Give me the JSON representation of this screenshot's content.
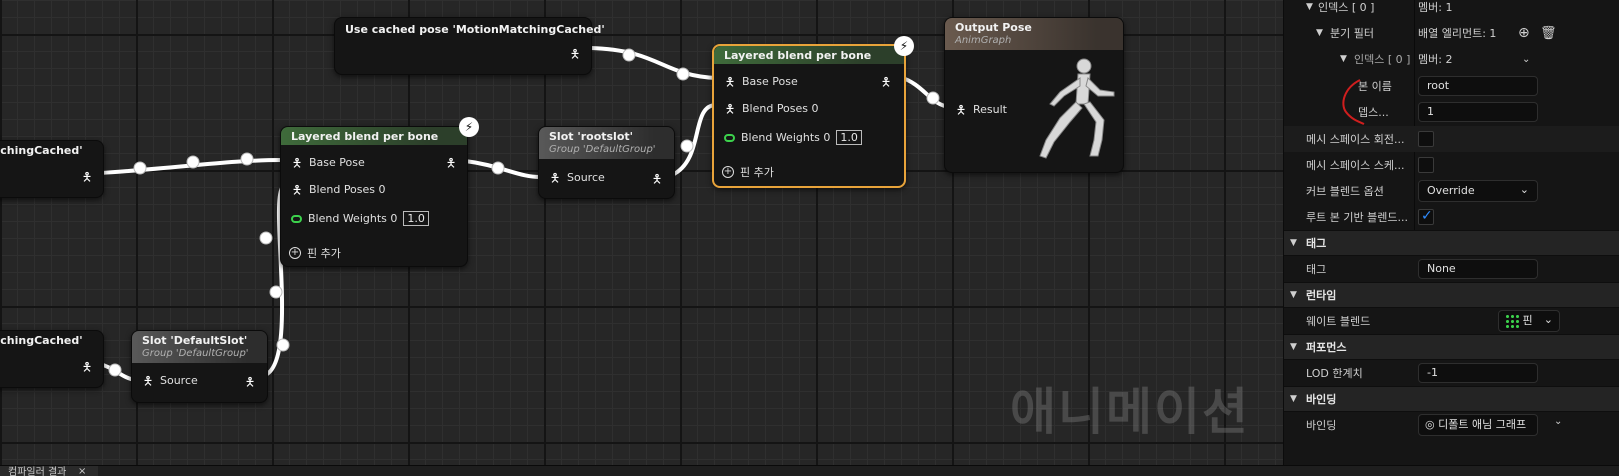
{
  "graph": {
    "watermark": "애니메이션",
    "cached_pose_node": {
      "title": "Use cached pose 'MotionMatchingCached'"
    },
    "left_node_1": {
      "title": "tchingCached'"
    },
    "left_node_2": {
      "title": "tchingCached'"
    },
    "slot_default": {
      "title": "Slot 'DefaultSlot'",
      "group": "Group 'DefaultGroup'",
      "source": "Source"
    },
    "layered_1": {
      "title": "Layered blend per bone",
      "base_pose": "Base Pose",
      "blend_poses": "Blend Poses 0",
      "blend_weights": "Blend Weights 0",
      "weight_value": "1.0",
      "add_pin": "핀 추가"
    },
    "slot_root": {
      "title": "Slot 'rootslot'",
      "group": "Group 'DefaultGroup'",
      "source": "Source"
    },
    "layered_2": {
      "title": "Layered blend per bone",
      "base_pose": "Base Pose",
      "blend_poses": "Blend Poses 0",
      "blend_weights": "Blend Weights 0",
      "weight_value": "1.0",
      "add_pin": "핀 추가"
    },
    "output_pose": {
      "title": "Output Pose",
      "subtitle": "AnimGraph",
      "result": "Result"
    }
  },
  "panel": {
    "rows": {
      "index0_top": {
        "label": "인덱스 [ 0 ]",
        "value": "멤버: 1"
      },
      "branch_filter": {
        "label": "분기 필터",
        "value": "배열 엘리먼트: 1"
      },
      "index0_inner": {
        "label": "인덱스 [ 0 ]",
        "value": "멤버: 2"
      },
      "bone_name": {
        "label": "본 이름",
        "value": "root"
      },
      "depth": {
        "label": "뎁스...",
        "value": "1"
      },
      "mesh_rot": {
        "label": "메시 스페이스 회전..."
      },
      "mesh_scale": {
        "label": "메시 스페이스 스케..."
      },
      "curve_blend": {
        "label": "커브 블렌드 옵션",
        "value": "Override"
      },
      "root_bone": {
        "label": "루트 본 기반 블렌드..."
      },
      "tag": {
        "label": "태그",
        "value": "None"
      },
      "weight_blend": {
        "label": "웨이트 블렌드",
        "value": "핀"
      },
      "lod": {
        "label": "LOD 한계치",
        "value": "-1"
      },
      "binding": {
        "label": "바인딩",
        "value": "디폴트 애님 그래프 ..."
      }
    },
    "sections": {
      "tag": "태그",
      "runtime": "런타임",
      "performance": "퍼포먼스",
      "binding": "바인딩"
    }
  },
  "bottom": {
    "tab_label": "컴파일러 결과"
  },
  "colors": {
    "selected_border": "#e8a33a",
    "accent_blue": "#2f8cff",
    "pin_green": "#3cd14c"
  }
}
